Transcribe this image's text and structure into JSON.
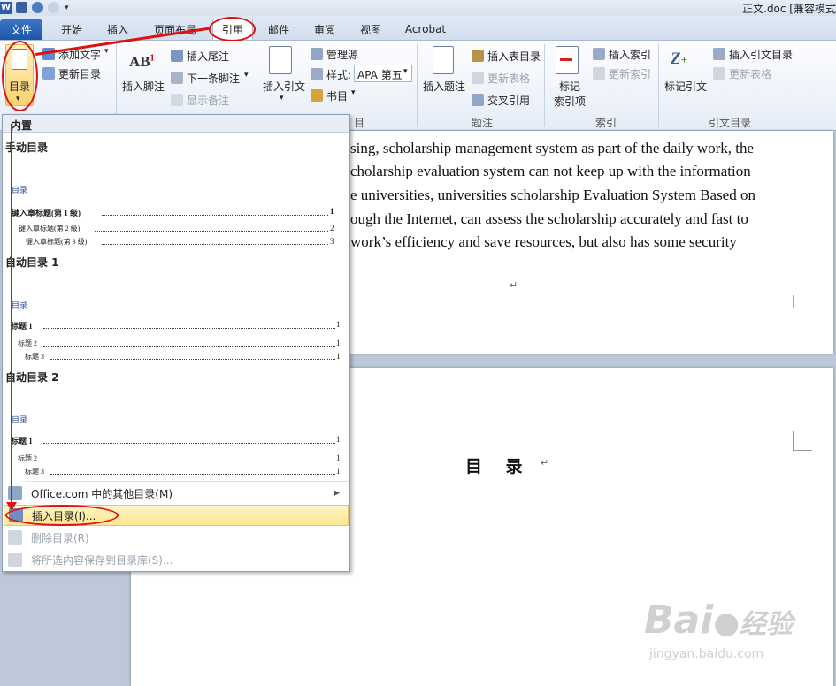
{
  "window": {
    "document_title": "正文.doc [兼容模式"
  },
  "tabs": [
    {
      "label": "文件"
    },
    {
      "label": "开始"
    },
    {
      "label": "插入"
    },
    {
      "label": "页面布局"
    },
    {
      "label": "引用"
    },
    {
      "label": "邮件"
    },
    {
      "label": "审阅"
    },
    {
      "label": "视图"
    },
    {
      "label": "Acrobat"
    }
  ],
  "ribbon": {
    "toc": {
      "toc_button": "目录",
      "add_text": "添加文字",
      "update_toc": "更新目录"
    },
    "footnotes": {
      "insert_footnote": "插入脚注",
      "insert_endnote": "插入尾注",
      "next_footnote": "下一条脚注",
      "show_notes": "显示备注"
    },
    "citations": {
      "insert_citation": "插入引文",
      "manage_sources": "管理源",
      "style_label": "样式:",
      "style_value": "APA 第五",
      "bibliography": "书目",
      "group_label": "目"
    },
    "captions": {
      "insert_caption": "插入题注",
      "insert_table_of_figures": "插入表目录",
      "update_table": "更新表格",
      "cross_reference": "交叉引用",
      "group_label": "题注"
    },
    "index": {
      "mark_entry": "标记\n索引项",
      "mark_entry_line1": "标记",
      "mark_entry_line2": "索引项",
      "insert_index": "插入索引",
      "update_index": "更新索引",
      "group_label": "索引"
    },
    "table_of_authorities": {
      "mark_citation": "标记引文",
      "insert_toa": "插入引文目录",
      "update_table": "更新表格",
      "group_label": "引文目录"
    }
  },
  "dropdown": {
    "section_builtin": "内置",
    "manual_toc": {
      "name": "手动目录",
      "preview_title": "目录",
      "lines": [
        {
          "text": "键入章标题(第 1 级)",
          "page": "1"
        },
        {
          "text": "键入章标题(第 2 级)",
          "page": "2"
        },
        {
          "text": "键入章标题(第 3 级)",
          "page": "3"
        }
      ]
    },
    "auto_toc_1": {
      "name": "自动目录 1",
      "preview_title": "目录",
      "lines": [
        {
          "text": "标题 1",
          "page": "1"
        },
        {
          "text": "标题 2",
          "page": "1"
        },
        {
          "text": "标题 3",
          "page": "1"
        }
      ]
    },
    "auto_toc_2": {
      "name": "自动目录 2",
      "preview_title": "目录",
      "lines": [
        {
          "text": "标题 1",
          "page": "1"
        },
        {
          "text": "标题 2",
          "page": "1"
        },
        {
          "text": "标题 3",
          "page": "1"
        }
      ]
    },
    "menu": {
      "more_toc": "Office.com 中的其他目录(M)",
      "insert_toc": "插入目录(I)...",
      "remove_toc": "删除目录(R)",
      "save_selection": "将所选内容保存到目录库(S)..."
    }
  },
  "document": {
    "lines": [
      "sing, scholarship management system as part of the daily work, the",
      "cholarship evaluation system can not keep up with the information",
      "e universities, universities scholarship Evaluation System Based on",
      "ough the Internet, can assess the scholarship accurately and fast to",
      "work’s efficiency and save resources, but also has some security"
    ],
    "para_mark": "↵",
    "heading": "目    录"
  },
  "watermark": {
    "brand": "Bai",
    "brand_cn": "经验",
    "url": "jingyan.baidu.com"
  },
  "colors": {
    "accent_red": "#e01010",
    "file_tab": "#2a5caa",
    "highlight": "#fde78f"
  }
}
